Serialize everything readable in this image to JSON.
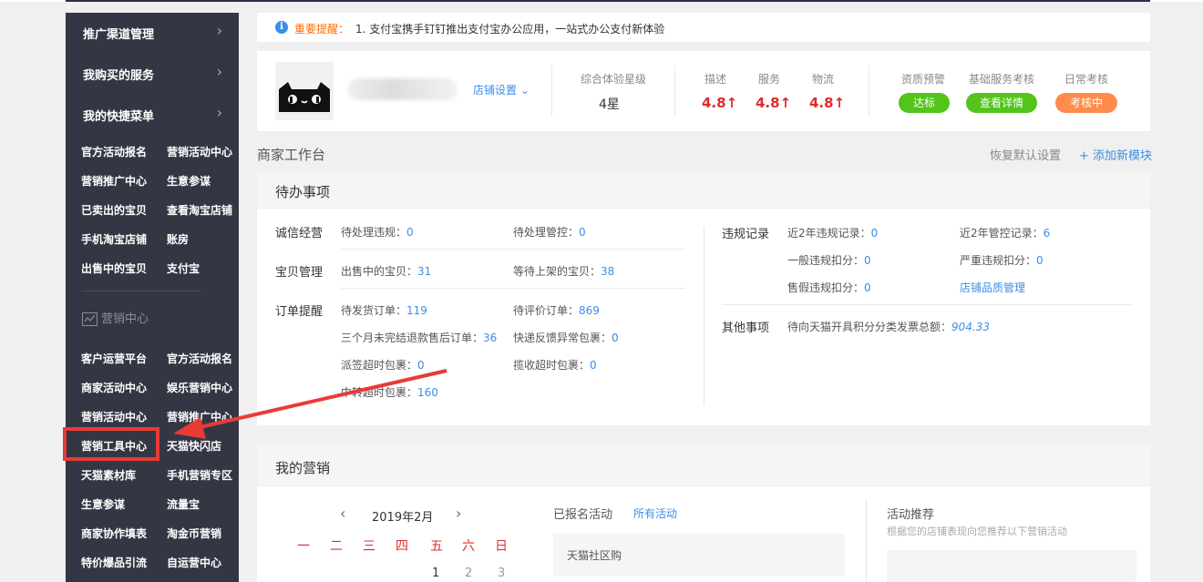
{
  "sidebar": {
    "groups": [
      {
        "label": "推广渠道管理"
      },
      {
        "label": "我购买的服务"
      },
      {
        "label": "我的快捷菜单"
      }
    ],
    "shortcuts": [
      [
        "官方活动报名",
        "营销活动中心"
      ],
      [
        "营销推广中心",
        "生意参谋"
      ],
      [
        "已卖出的宝贝",
        "查看淘宝店铺"
      ],
      [
        "手机淘宝店铺",
        "账房"
      ],
      [
        "出售中的宝贝",
        "支付宝"
      ]
    ],
    "section_title": "营销中心",
    "marketing": [
      [
        "客户运营平台",
        "官方活动报名"
      ],
      [
        "商家活动中心",
        "娱乐营销中心"
      ],
      [
        "营销活动中心",
        "营销推广中心"
      ],
      [
        "营销工具中心",
        "天猫快闪店"
      ],
      [
        "天猫素材库",
        "手机营销专区"
      ],
      [
        "生意参谋",
        "流量宝"
      ],
      [
        "商家协作填表",
        "淘金币营销"
      ],
      [
        "特价爆品引流",
        "自运营中心"
      ]
    ]
  },
  "notice": {
    "tag": "重要提醒：",
    "message": "1. 支付宝携手钉钉推出支付宝办公应用，一站式办公支付新体验"
  },
  "shop": {
    "settings_label": "店铺设置",
    "overall_label": "综合体验星级",
    "overall_value": "4星",
    "ratings": [
      {
        "label": "描述",
        "value": "4.8↑"
      },
      {
        "label": "服务",
        "value": "4.8↑"
      },
      {
        "label": "物流",
        "value": "4.8↑"
      }
    ],
    "checks": [
      {
        "label": "资质预警",
        "pill": "达标",
        "color": "#52c41a"
      },
      {
        "label": "基础服务考核",
        "pill": "查看详情",
        "color": "#52c41a"
      },
      {
        "label": "日常考核",
        "pill": "考核中",
        "color": "#ff8c4b"
      }
    ]
  },
  "workspace": {
    "title": "商家工作台",
    "restore": "恢复默认设置",
    "add_module": "+ 添加新模块"
  },
  "todo": {
    "title": "待办事项",
    "integrity": {
      "label": "诚信经营",
      "a_label": "待处理违规：",
      "a_value": "0",
      "b_label": "待处理管控：",
      "b_value": "0"
    },
    "items": {
      "label": "宝贝管理",
      "a_label": "出售中的宝贝：",
      "a_value": "31",
      "b_label": "等待上架的宝贝：",
      "b_value": "38"
    },
    "orders": {
      "label": "订单提醒",
      "r1a_label": "待发货订单：",
      "r1a_value": "119",
      "r1b_label": "待评价订单：",
      "r1b_value": "869",
      "r2a_label": "三个月未完结退款售后订单：",
      "r2a_value": "36",
      "r2b_label": "快递反馈异常包裹：",
      "r2b_value": "0",
      "r3a_label": "派签超时包裹：",
      "r3a_value": "0",
      "r3b_label": "揽收超时包裹：",
      "r3b_value": "0",
      "r4a_label": "中转超时包裹：",
      "r4a_value": "160"
    },
    "violations": {
      "label": "违规记录",
      "r1a_label": "近2年违规记录：",
      "r1a_value": "0",
      "r1b_label": "近2年管控记录：",
      "r1b_value": "6",
      "r2a_label": "一般违规扣分：",
      "r2a_value": "0",
      "r2b_label": "严重违规扣分：",
      "r2b_value": "0",
      "r3a_label": "售假违规扣分：",
      "r3a_value": "0",
      "r3b_link": "店铺品质管理"
    },
    "other": {
      "label": "其他事项",
      "a_label": "待向天猫开具积分分类发票总额：",
      "a_value": "904.33"
    }
  },
  "marketing": {
    "title": "我的营销",
    "calendar": {
      "month": "2019年2月",
      "weekdays": [
        "一",
        "二",
        "三",
        "四",
        "五",
        "六",
        "日"
      ],
      "days": [
        "1",
        "2",
        "3"
      ]
    },
    "registered": {
      "title": "已报名活动",
      "link": "所有活动",
      "item": "天猫社区购"
    },
    "recommend": {
      "title": "活动推荐",
      "subtitle": "根据您的店铺表现向您推荐以下营销活动"
    }
  }
}
